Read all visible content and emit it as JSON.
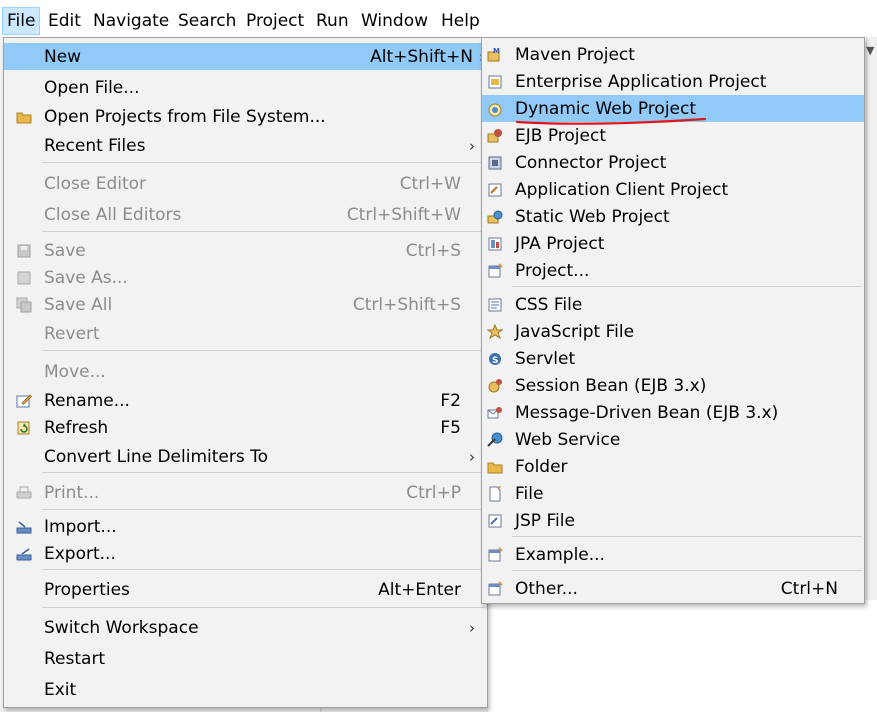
{
  "menubar": {
    "items": [
      "File",
      "Edit",
      "Navigate",
      "Search",
      "Project",
      "Run",
      "Window",
      "Help"
    ]
  },
  "file_menu": {
    "new": {
      "label": "New",
      "shortcut": "Alt+Shift+N"
    },
    "open_file": {
      "label": "Open File..."
    },
    "open_projects": {
      "label": "Open Projects from File System..."
    },
    "recent_files": {
      "label": "Recent Files"
    },
    "close_editor": {
      "label": "Close Editor",
      "shortcut": "Ctrl+W"
    },
    "close_all_editors": {
      "label": "Close All Editors",
      "shortcut": "Ctrl+Shift+W"
    },
    "save": {
      "label": "Save",
      "shortcut": "Ctrl+S"
    },
    "save_as": {
      "label": "Save As..."
    },
    "save_all": {
      "label": "Save All",
      "shortcut": "Ctrl+Shift+S"
    },
    "revert": {
      "label": "Revert"
    },
    "move": {
      "label": "Move..."
    },
    "rename": {
      "label": "Rename...",
      "shortcut": "F2"
    },
    "refresh": {
      "label": "Refresh",
      "shortcut": "F5"
    },
    "convert_line_delimiters": {
      "label": "Convert Line Delimiters To"
    },
    "print": {
      "label": "Print...",
      "shortcut": "Ctrl+P"
    },
    "import": {
      "label": "Import..."
    },
    "export": {
      "label": "Export..."
    },
    "properties": {
      "label": "Properties",
      "shortcut": "Alt+Enter"
    },
    "switch_workspace": {
      "label": "Switch Workspace"
    },
    "restart": {
      "label": "Restart"
    },
    "exit": {
      "label": "Exit"
    }
  },
  "new_menu": {
    "maven_project": {
      "label": "Maven Project"
    },
    "enterprise_app_project": {
      "label": "Enterprise Application Project"
    },
    "dynamic_web_project": {
      "label": "Dynamic Web Project"
    },
    "ejb_project": {
      "label": "EJB Project"
    },
    "connector_project": {
      "label": "Connector Project"
    },
    "app_client_project": {
      "label": "Application Client Project"
    },
    "static_web_project": {
      "label": "Static Web Project"
    },
    "jpa_project": {
      "label": "JPA Project"
    },
    "project": {
      "label": "Project..."
    },
    "css_file": {
      "label": "CSS File"
    },
    "javascript_file": {
      "label": "JavaScript File"
    },
    "servlet": {
      "label": "Servlet"
    },
    "session_bean": {
      "label": "Session Bean (EJB 3.x)"
    },
    "mdb": {
      "label": "Message-Driven Bean (EJB 3.x)"
    },
    "web_service": {
      "label": "Web Service"
    },
    "folder": {
      "label": "Folder"
    },
    "file": {
      "label": "File"
    },
    "jsp_file": {
      "label": "JSP File"
    },
    "example": {
      "label": "Example..."
    },
    "other": {
      "label": "Other...",
      "shortcut": "Ctrl+N"
    }
  },
  "colors": {
    "highlight": "#91c9f7",
    "menu_bg": "#f2f2f2",
    "disabled_text": "#8c8c8c",
    "annotation_underline": "#e0141e"
  }
}
